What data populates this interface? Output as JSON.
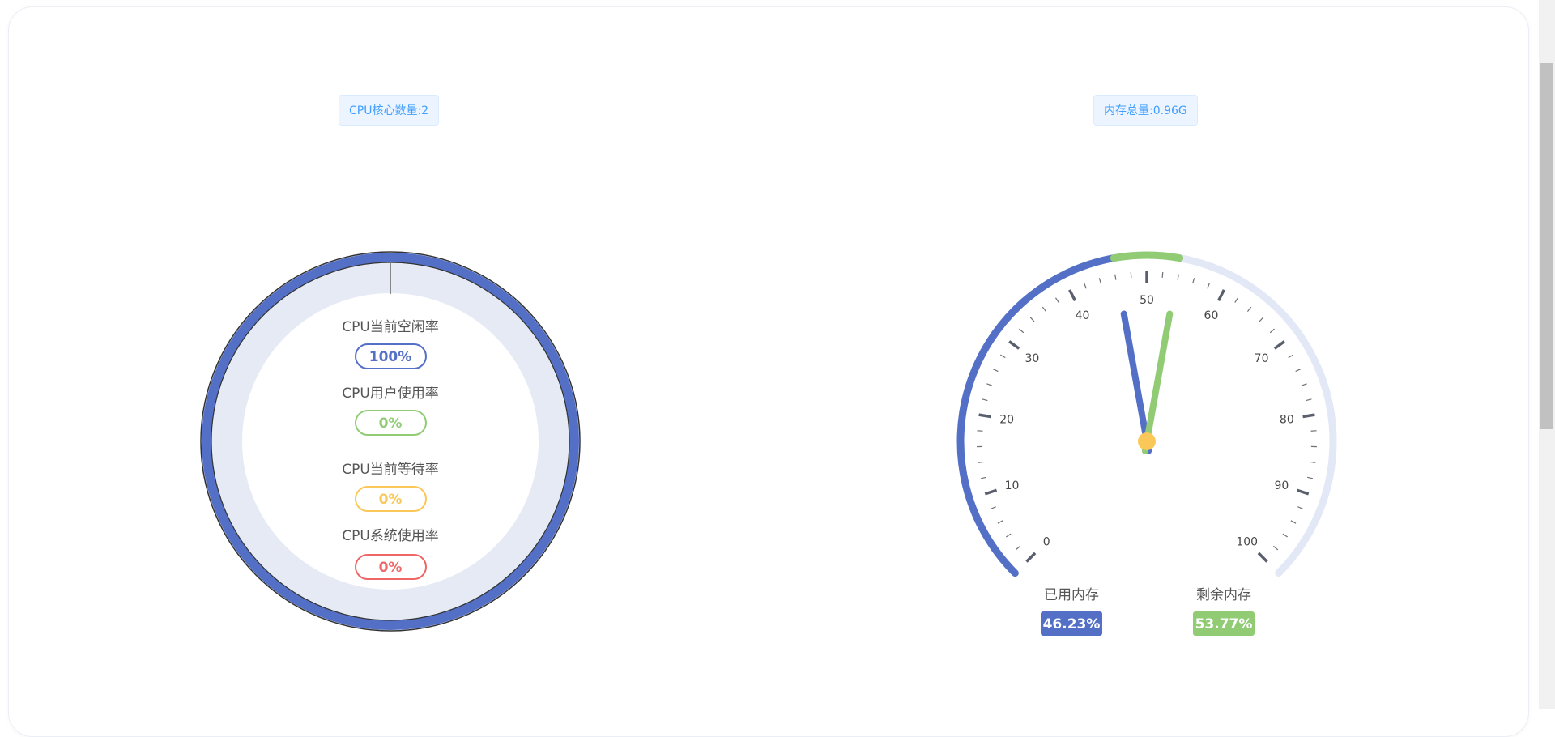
{
  "cpu": {
    "core_tag": "CPU核心数量:2",
    "idle_label": "CPU当前空闲率",
    "idle_value": "100%",
    "user_label": "CPU用户使用率",
    "user_value": "0%",
    "wait_label": "CPU当前等待率",
    "wait_value": "0%",
    "sys_label": "CPU系统使用率",
    "sys_value": "0%",
    "colors": {
      "idle": "#5470c6",
      "user": "#91cc75",
      "wait": "#fac858",
      "sys": "#ee6666",
      "track": "#e5eaf5"
    }
  },
  "memory": {
    "total_tag": "内存总量:0.96G",
    "used_label": "已用内存",
    "used_value": "46.23%",
    "free_label": "剩余内存",
    "free_value": "53.77%",
    "used_percent": 46.23,
    "free_percent": 53.77,
    "gauge_ticks": [
      "0",
      "10",
      "20",
      "30",
      "40",
      "50",
      "60",
      "70",
      "80",
      "90",
      "100"
    ],
    "colors": {
      "used": "#5470c6",
      "free": "#91cc75",
      "track": "#e3e8f6",
      "pointer_center": "#fac858",
      "tick": "#464646"
    }
  }
}
